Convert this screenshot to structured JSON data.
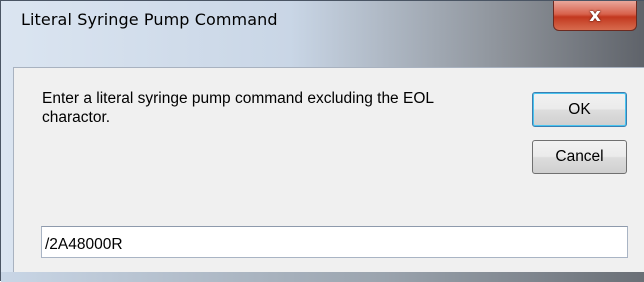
{
  "window": {
    "title": "Literal Syringe Pump Command",
    "close_icon": "close-x",
    "close_glyph": "x"
  },
  "dialog": {
    "prompt": "Enter a literal syringe pump command excluding the EOL charactor.",
    "ok_label": "OK",
    "cancel_label": "Cancel",
    "command_value": "/2A48000R"
  },
  "colors": {
    "close_button": "#c2381f",
    "client_bg": "#f0f0f0",
    "default_button_border": "#3c7fb1"
  }
}
